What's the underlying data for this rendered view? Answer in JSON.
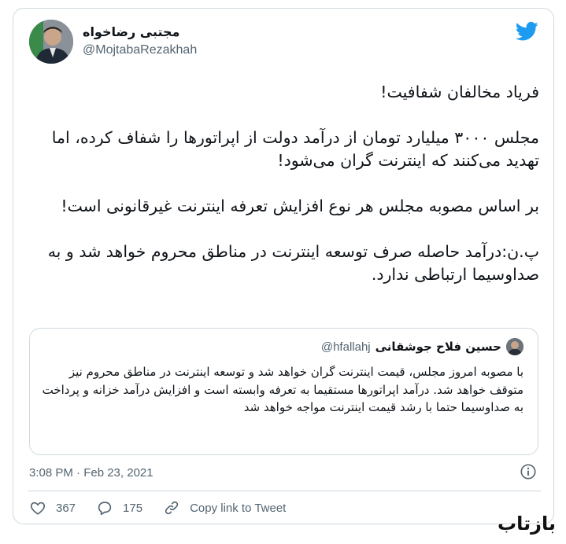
{
  "colors": {
    "twitter_blue": "#1d9bf0",
    "text": "#0f1419",
    "muted": "#536471",
    "border": "#cfd9de"
  },
  "author": {
    "name": "مجتبی رضاخواه",
    "handle": "@MojtabaRezakhah"
  },
  "tweet": {
    "paragraphs": [
      "فریاد مخالفان شفافیت!",
      "مجلس ۳۰۰۰ میلیارد تومان از درآمد دولت از اپراتورها را شفاف کرده، اما تهدید می‌کنند که اینترنت گران می‌شود!",
      "بر اساس مصوبه مجلس هر نوع افزایش تعرفه اینترنت غیرقانونی است!",
      "پ.ن:درآمد حاصله صرف توسعه اینترنت در مناطق محروم خواهد شد و به صداوسیما ارتباطی ندارد."
    ]
  },
  "quoted": {
    "name": "حسین فلاح جوشقانی",
    "handle": "@hfallahj",
    "text": "با مصوبه امروز مجلس، قیمت اینترنت گران خواهد شد و توسعه اینترنت در مناطق محروم نیز متوقف خواهد شد. درآمد اپراتورها مستقیما به تعرفه وابسته است و افزایش درآمد خزانه و پرداخت به صداوسیما حتما با رشد قیمت اینترنت مواجه خواهد شد"
  },
  "meta": {
    "timestamp": "3:08 PM · Feb 23, 2021"
  },
  "actions": {
    "likes": "367",
    "replies": "175",
    "copy_link": "Copy link to Tweet"
  },
  "watermark": {
    "text": "بازتاب"
  },
  "icons": [
    "twitter-bird-icon",
    "info-icon",
    "heart-icon",
    "reply-bubble-icon",
    "link-icon"
  ]
}
